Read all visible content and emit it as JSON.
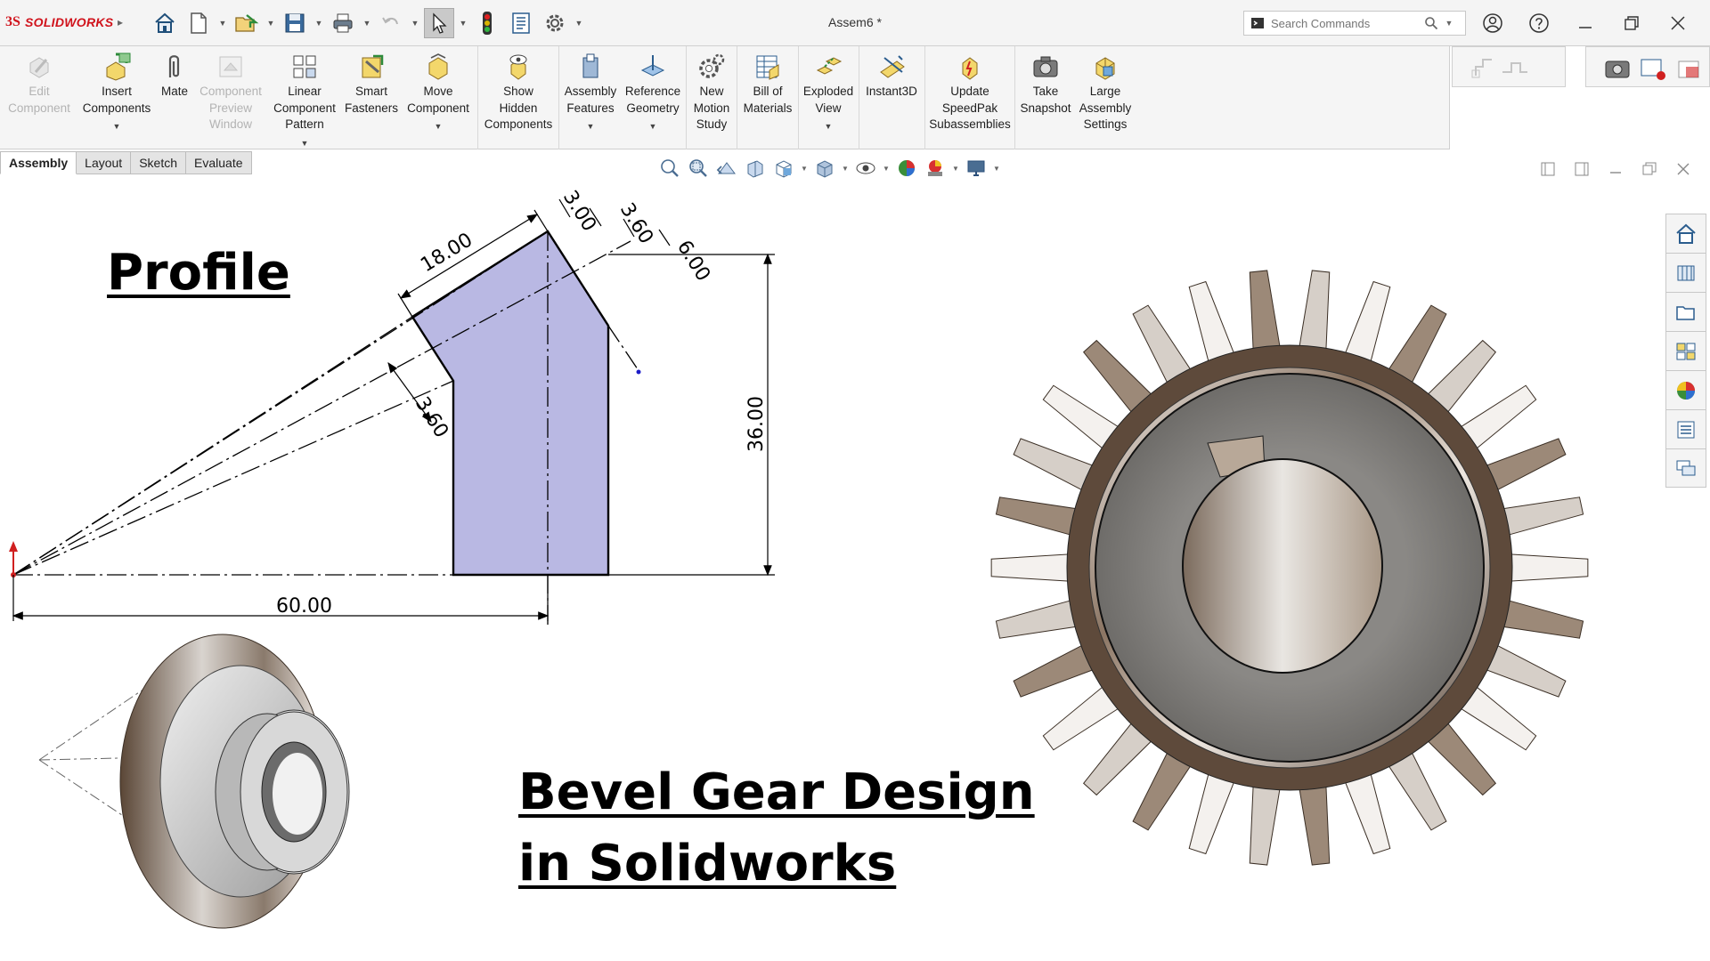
{
  "app": {
    "logo_text": "SOLIDWORKS",
    "logo_mark": "3S",
    "document_title": "Assem6 *",
    "brand_color": "#d0121b"
  },
  "quick_access": [
    {
      "name": "home-icon"
    },
    {
      "name": "new-document-icon"
    },
    {
      "name": "open-document-icon"
    },
    {
      "name": "save-icon"
    },
    {
      "name": "print-icon"
    },
    {
      "name": "undo-icon"
    },
    {
      "name": "select-arrow-icon"
    },
    {
      "name": "rebuild-traffic-light-icon"
    },
    {
      "name": "file-properties-icon"
    },
    {
      "name": "options-gear-icon"
    }
  ],
  "search": {
    "placeholder": "Search Commands"
  },
  "ribbon": {
    "tools": [
      {
        "id": "edit-component",
        "label": "Edit\nComponent",
        "enabled": false
      },
      {
        "id": "insert-components",
        "label": "Insert\nComponents",
        "enabled": true
      },
      {
        "id": "mate",
        "label": "Mate",
        "enabled": true
      },
      {
        "id": "component-preview-window",
        "label": "Component\nPreview\nWindow",
        "enabled": false
      },
      {
        "id": "linear-component-pattern",
        "label": "Linear\nComponent\nPattern",
        "enabled": true
      },
      {
        "id": "smart-fasteners",
        "label": "Smart\nFasteners",
        "enabled": true
      },
      {
        "id": "move-component",
        "label": "Move\nComponent",
        "enabled": true
      },
      {
        "id": "show-hidden-components",
        "label": "Show\nHidden\nComponents",
        "enabled": true
      },
      {
        "id": "assembly-features",
        "label": "Assembly\nFeatures",
        "enabled": true
      },
      {
        "id": "reference-geometry",
        "label": "Reference\nGeometry",
        "enabled": true
      },
      {
        "id": "new-motion-study",
        "label": "New\nMotion\nStudy",
        "enabled": true
      },
      {
        "id": "bill-of-materials",
        "label": "Bill of\nMaterials",
        "enabled": true
      },
      {
        "id": "exploded-view",
        "label": "Exploded\nView",
        "enabled": true
      },
      {
        "id": "instant3d",
        "label": "Instant3D",
        "enabled": true
      },
      {
        "id": "update-speedpak",
        "label": "Update\nSpeedPak\nSubassemblies",
        "enabled": true
      },
      {
        "id": "take-snapshot",
        "label": "Take\nSnapshot",
        "enabled": true
      },
      {
        "id": "large-assembly-settings",
        "label": "Large\nAssembly\nSettings",
        "enabled": true
      }
    ]
  },
  "tabs": [
    "Assembly",
    "Layout",
    "Sketch",
    "Evaluate"
  ],
  "active_tab": "Assembly",
  "canvas": {
    "heading_profile": "Profile",
    "heading_title_line1": "Bevel Gear Design",
    "heading_title_line2": "in Solidworks",
    "profile_fill": "#b9b8e3",
    "dimensions": {
      "slant_length": "18.00",
      "top_offset": "3.00",
      "tooth_depth_top": "3.60",
      "face_width": "6.00",
      "tooth_depth_side": "3.60",
      "height": "36.00",
      "base_length": "60.00"
    }
  },
  "task_pane": [
    {
      "name": "home-icon"
    },
    {
      "name": "design-library-icon"
    },
    {
      "name": "file-explorer-icon"
    },
    {
      "name": "view-palette-icon"
    },
    {
      "name": "appearances-icon"
    },
    {
      "name": "custom-properties-icon"
    },
    {
      "name": "forum-icon"
    }
  ]
}
